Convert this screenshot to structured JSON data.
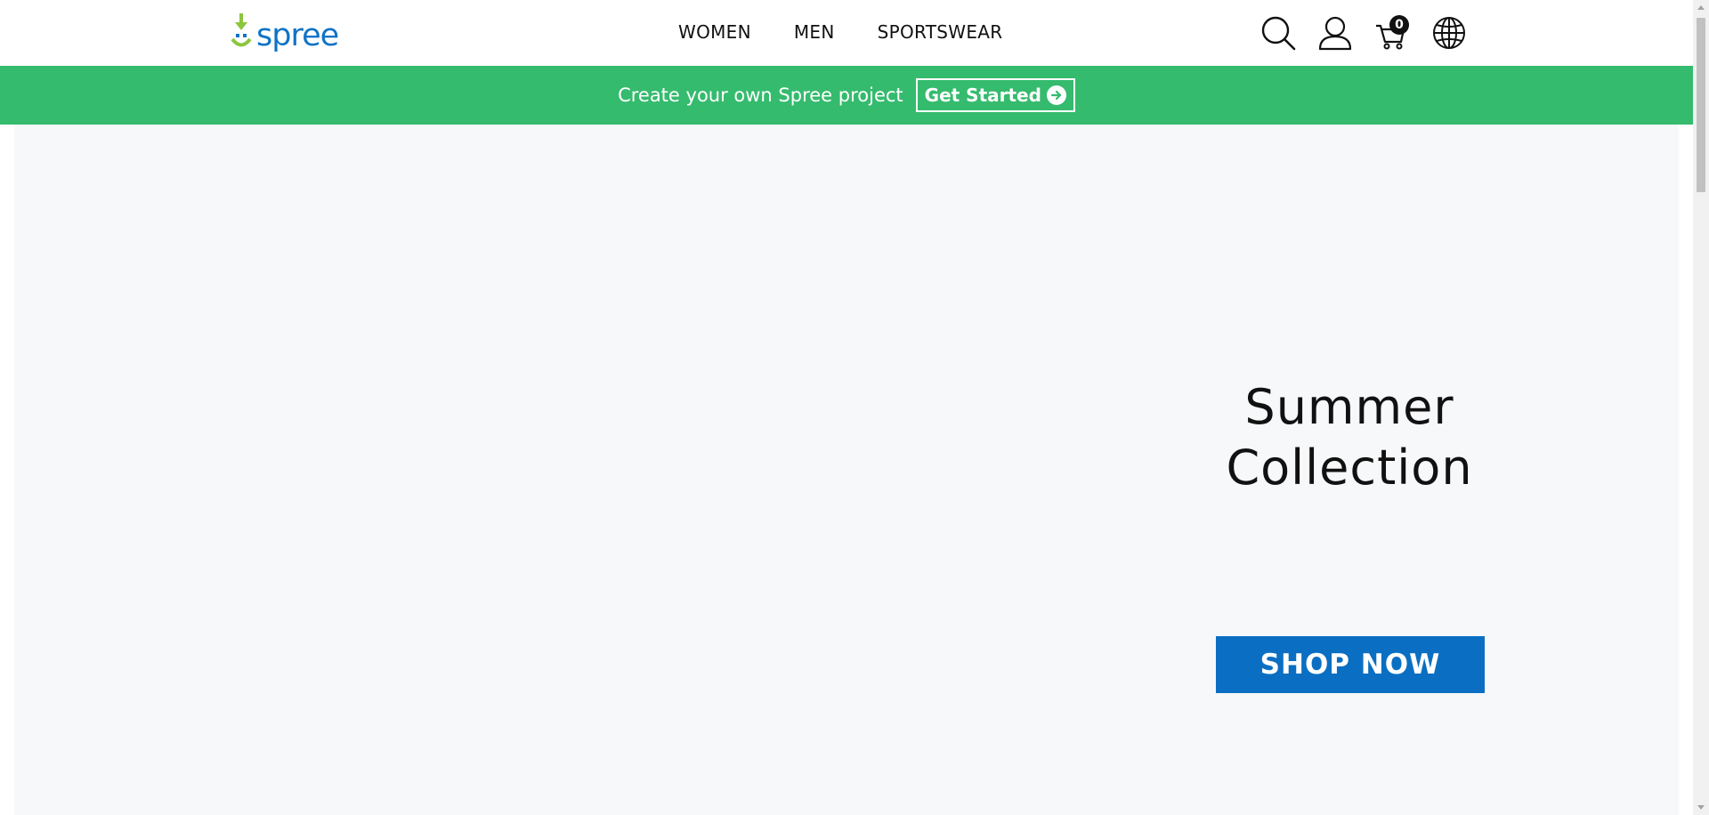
{
  "header": {
    "logo_text": "spree",
    "nav": [
      {
        "label": "WOMEN"
      },
      {
        "label": "MEN"
      },
      {
        "label": "SPORTSWEAR"
      }
    ],
    "icons": {
      "search": "search-icon",
      "account": "user-icon",
      "cart": "cart-icon",
      "language": "globe-icon"
    },
    "cart_count": "0"
  },
  "banner": {
    "text": "Create your own Spree project",
    "button_label": "Get Started",
    "background": "#35bb6e"
  },
  "hero": {
    "title": "Summer Collection",
    "button_label": "SHOP NOW",
    "button_color": "#0a6fc2",
    "background": "#f7f8fa"
  }
}
